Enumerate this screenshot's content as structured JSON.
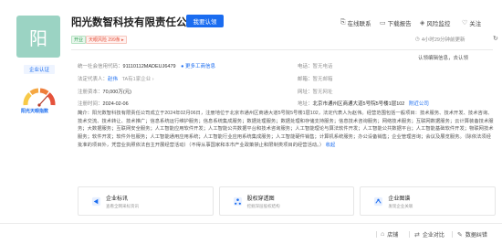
{
  "company": {
    "logo_char": "阳",
    "name": "阳光数智科技有限责任公司",
    "claim_label": "我要认领",
    "tag_status": "开业",
    "tag_risk": "天眼风险 299条 ▸",
    "update_note": "4小时29分钟前更新",
    "badge_enterprise": "企业认证",
    "gauge_label": "阳光天眼指数"
  },
  "toolbar": {
    "contact": "在线联系",
    "report": "下载报告",
    "monitor": "风险监控",
    "follow": "关注"
  },
  "info": {
    "credit_code_label": "统一社会信用代码：",
    "credit_code_value": "91110112MADEUJ6479",
    "credit_more": "更多工商信息",
    "legal_label": "法定代表人：",
    "legal_value": "赵伟",
    "legal_suffix": "TA有1家企业",
    "capital_label": "注册资本：",
    "capital_value": "70,000万(元)",
    "date_label": "注册时间：",
    "date_value": "2024-02-06",
    "phone_label": "电话：",
    "phone_value": "暂无电话",
    "email_label": "邮箱：",
    "email_value": "暂无邮箱",
    "website_label": "网址：",
    "website_value": "暂无网址",
    "address_label": "地址：",
    "address_value": "北京市通州区商通大道5号院5号楼1层102",
    "address_link": "附近公司",
    "side_note": "认领编辑信息，去认领"
  },
  "intro": {
    "label": "简介：",
    "text": "阳光数智科技有限责任公司成立于2024年02月06日，注册地位于北京市通州区商通大道5号院5号楼1层102，法定代表人为赵伟。经营范围包括一般项目：技术服务、技术开发、技术咨询、技术交流、技术转让、技术推广；信息系统运行维护服务；信息系统集成服务；数据处理服务；数据处理和存储支持服务；信息技术咨询服务；网络技术服务；互联网数据服务；云计算装备技术服务；大数据服务；互联网安全服务；人工智能应用软件开发；人工智能公共数据平台和技术咨询服务；人工智能理论与算法软件开发；人工智能公共数据平台；人工智能基础软件开发；物联网技术服务；软件开发；软件外包服务；人工智能通用应用系统；人工智能行业应用系统集成服务；人工智能硬件销售；计算机系统服务；办公设备销售；企业管理咨询；会议及展览服务。（除依法须经批准的项目外，凭营业执照依法自主开展经营活动）（不得从事国家和本市产业政策禁止和限制类项目的经营活动。）",
    "more": "收起"
  },
  "tiles": [
    {
      "title": "企业标讯",
      "sub": "查看全网采标资讯"
    },
    {
      "title": "股权穿透图",
      "sub": "挖掘深层股权结构"
    },
    {
      "title": "企业图谱",
      "sub": "发现企业关联"
    }
  ],
  "bottom": {
    "store": "店铺",
    "compare": "企业对比",
    "correct": "数据纠错"
  },
  "colors": {
    "accent": "#1a6cf0",
    "logo_bg": "#9bd3c3",
    "status_green": "#30a052",
    "risk_red": "#e5523b"
  }
}
